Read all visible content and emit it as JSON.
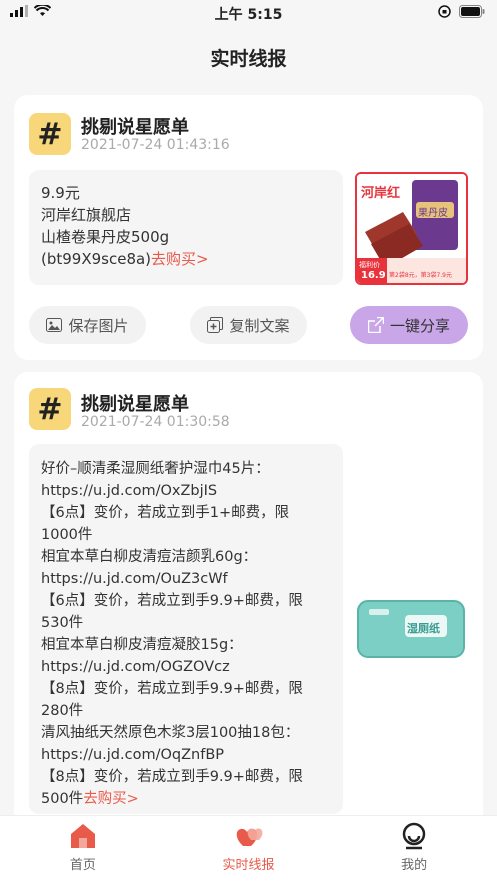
{
  "status_bar": {
    "time": "上午 5:15"
  },
  "nav": {
    "title": "实时线报"
  },
  "posts": [
    {
      "title": "挑剔说星愿单",
      "time": "2021-07-24 01:43:16",
      "lines": [
        "9.9元",
        "河岸红旗舰店",
        "山楂卷果丹皮500g"
      ],
      "last_line": "(bt99X9sce8a)",
      "buy_label": "去购买>",
      "image": {
        "brand": "河岸红",
        "product": "果丹皮",
        "tag": "福利价",
        "price": "16.9",
        "promo": "第2袋8元，第3袋7.9元"
      }
    },
    {
      "title": "挑剔说星愿单",
      "time": "2021-07-24 01:30:58",
      "lines": [
        "好价–顺清柔湿厕纸奢护湿巾45片：",
        "https://u.jd.com/OxZbjIS",
        "【6点】变价，若成立到手1+邮费，限",
        "1000件",
        "相宜本草白柳皮清痘洁颜乳60g：",
        "https://u.jd.com/OuZ3cWf",
        "【6点】变价，若成立到手9.9+邮费，限",
        "530件",
        "相宜本草白柳皮清痘凝胶15g：",
        "https://u.jd.com/OGZOVcz",
        "【8点】变价，若成立到手9.9+邮费，限",
        "280件",
        "清风抽纸天然原色木浆3层100抽18包：",
        "https://u.jd.com/OqZnfBP",
        "【8点】变价，若成立到手9.9+邮费，限"
      ],
      "last_line": "500件",
      "buy_label": "去购买>",
      "image": {
        "product": "湿厕纸"
      }
    }
  ],
  "actions": {
    "save_image": "保存图片",
    "copy_text": "复制文案",
    "share": "一键分享"
  },
  "tabbar": [
    {
      "label": "首页",
      "icon": "home-icon"
    },
    {
      "label": "实时线报",
      "icon": "hearts-icon"
    },
    {
      "label": "我的",
      "icon": "profile-icon"
    }
  ],
  "colors": {
    "accent": "#e85a4a",
    "badge": "#f8d77a",
    "share": "#c9a6e8"
  }
}
